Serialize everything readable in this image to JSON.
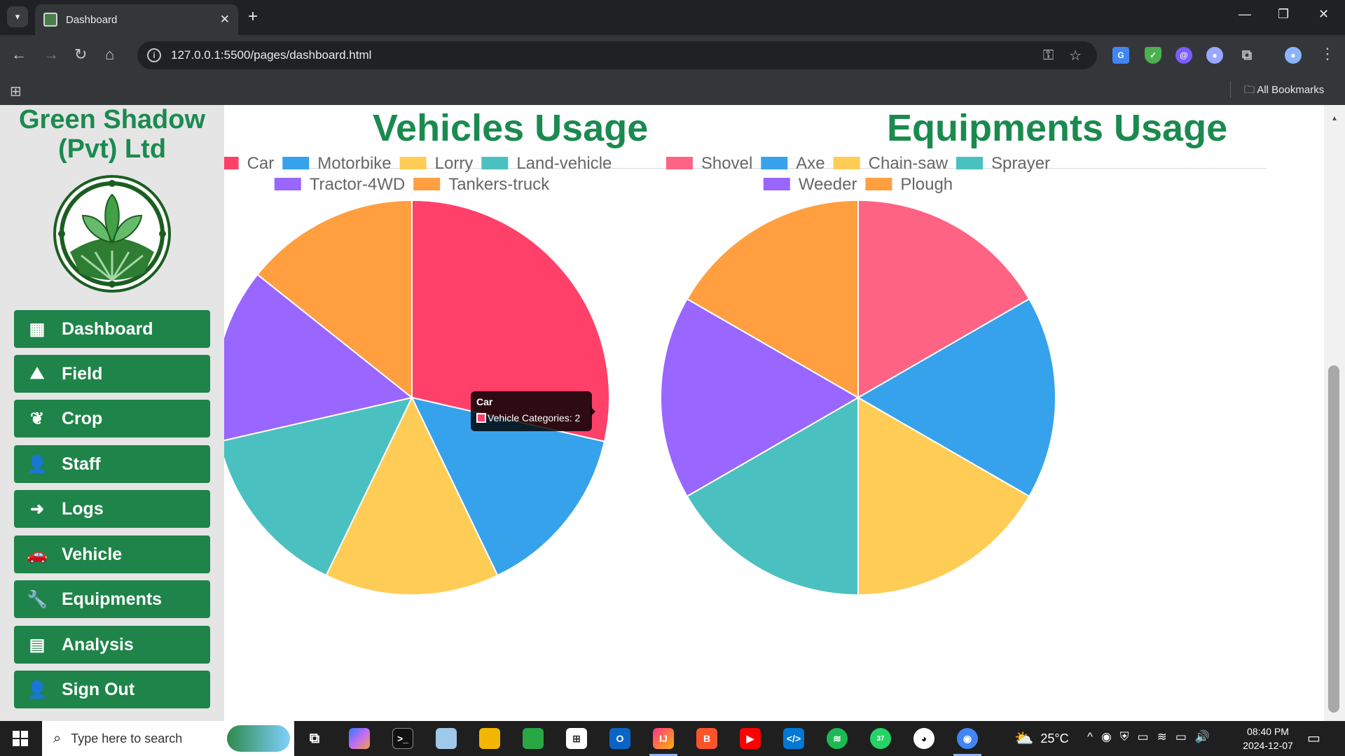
{
  "browser": {
    "tab_title": "Dashboard",
    "url": "127.0.0.1:5500/pages/dashboard.html",
    "all_bookmarks": "All Bookmarks"
  },
  "sidebar": {
    "brand_line1": "Green Shadow",
    "brand_line2": "(Pvt) Ltd",
    "items": [
      {
        "label": "Dashboard",
        "icon": "dashboard-grid-icon"
      },
      {
        "label": "Field",
        "icon": "mountain-icon"
      },
      {
        "label": "Crop",
        "icon": "leaf-icon"
      },
      {
        "label": "Staff",
        "icon": "user-icon"
      },
      {
        "label": "Logs",
        "icon": "arrow-circle-icon"
      },
      {
        "label": "Vehicle",
        "icon": "car-icon"
      },
      {
        "label": "Equipments",
        "icon": "wrench-icon"
      },
      {
        "label": "Analysis",
        "icon": "report-icon"
      },
      {
        "label": "Sign Out",
        "icon": "user-minus-icon"
      }
    ],
    "accent_color": "#1e8449"
  },
  "chart_data": [
    {
      "type": "pie",
      "title": "Vehicles Usage",
      "categories": [
        "Car",
        "Motorbike",
        "Lorry",
        "Land-vehicle",
        "Tractor-4WD",
        "Tankers-truck"
      ],
      "series": [
        {
          "name": "Vehicle Categories",
          "values": [
            2,
            1,
            1,
            1,
            1,
            1
          ]
        }
      ],
      "colors": [
        "#ff4069",
        "#36a2eb",
        "#ffcd56",
        "#4bc0c0",
        "#9966ff",
        "#ff9f40"
      ],
      "legend": "top",
      "tooltip": {
        "title": "Car",
        "label": "Vehicle Categories: 2",
        "active_index": 0
      }
    },
    {
      "type": "pie",
      "title": "Equipments Usage",
      "categories": [
        "Shovel",
        "Axe",
        "Chain-saw",
        "Sprayer",
        "Weeder",
        "Plough"
      ],
      "values": [
        1,
        1,
        1,
        1,
        1,
        1
      ],
      "colors": [
        "#ff6384",
        "#36a2eb",
        "#ffcd56",
        "#4bc0c0",
        "#9966ff",
        "#ff9f40"
      ],
      "legend": "top"
    }
  ],
  "taskbar": {
    "search_placeholder": "Type here to search",
    "weather": "25°C",
    "time": "08:40 PM",
    "date": "2024-12-07",
    "whatsapp_badge": "37"
  }
}
